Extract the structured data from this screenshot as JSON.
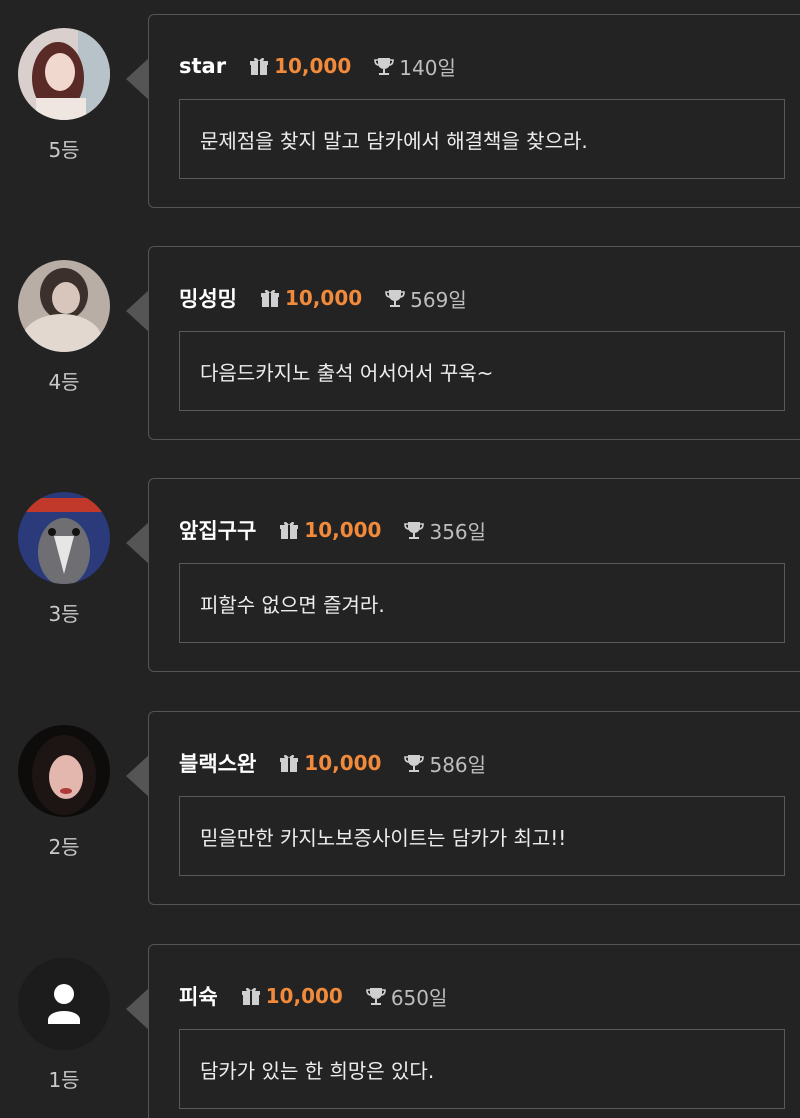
{
  "entries": [
    {
      "rank": "5등",
      "nickname": "star",
      "points": "10,000",
      "days": "140일",
      "message": "문제점을 찾지 말고 담카에서 해결책을 찾으라.",
      "avatar": "photo"
    },
    {
      "rank": "4등",
      "nickname": "밍성밍",
      "points": "10,000",
      "days": "569일",
      "message": "다음드카지노 출석 어서어서 꾸욱~",
      "avatar": "photo"
    },
    {
      "rank": "3등",
      "nickname": "앞집구구",
      "points": "10,000",
      "days": "356일",
      "message": "피할수 없으면 즐겨라.",
      "avatar": "photo"
    },
    {
      "rank": "2등",
      "nickname": "블랙스완",
      "points": "10,000",
      "days": "586일",
      "message": "믿을만한 카지노보증사이트는 담카가 최고!!",
      "avatar": "photo"
    },
    {
      "rank": "1등",
      "nickname": "피슉",
      "points": "10,000",
      "days": "650일",
      "message": "담카가 있는 한 희망은 있다.",
      "avatar": "default-user-icon"
    }
  ],
  "colors": {
    "background": "#232323",
    "points_accent": "#f28a3c",
    "card_border": "#555555"
  },
  "icons": {
    "points": "gift-icon",
    "days": "trophy-icon"
  }
}
